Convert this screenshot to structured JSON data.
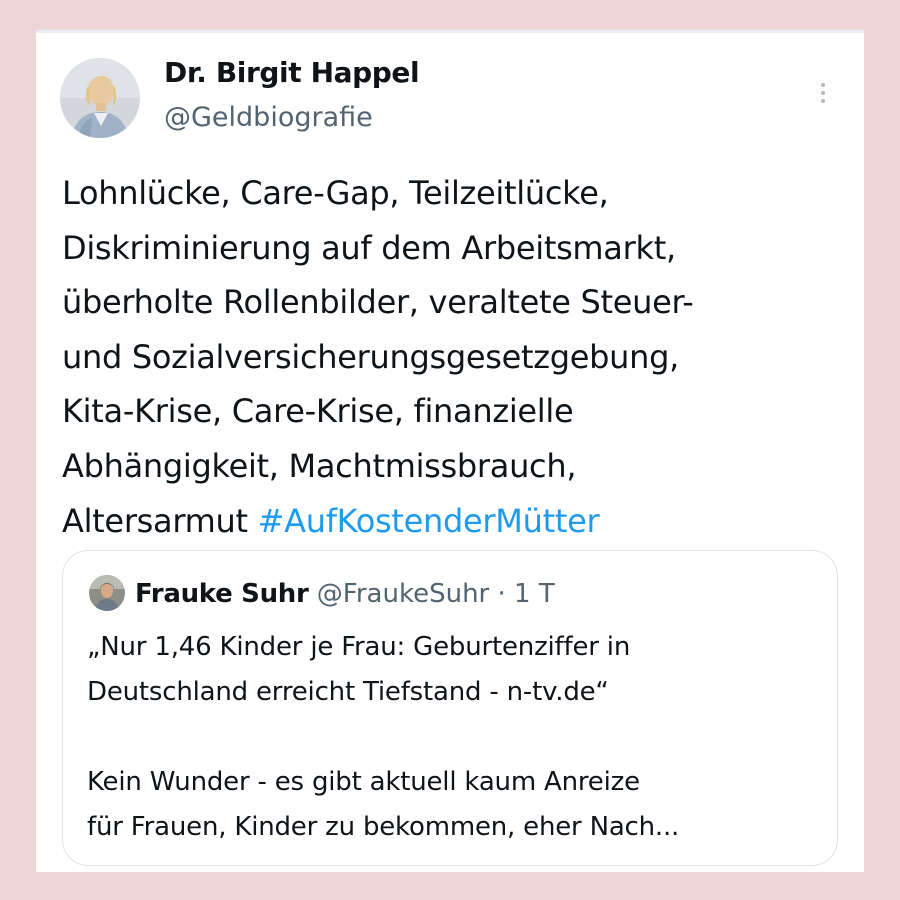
{
  "tweet": {
    "author_name": "Dr. Birgit Happel",
    "author_handle": "@Geldbiografie",
    "text_lines": [
      "Lohnlücke, Care-Gap, Teilzeitlücke,",
      "Diskriminierung auf dem Arbeitsmarkt,",
      "überholte Rollenbilder, veraltete Steuer-",
      "und Sozialversicherungsgesetzgebung,",
      "Kita-Krise, Care-Krise, finanzielle",
      "Abhängigkeit, Machtmissbrauch,",
      "Altersarmut"
    ],
    "hashtag": "#AufKostenderMütter",
    "more_icon": "more-vertical-icon"
  },
  "quote": {
    "author_name": "Frauke Suhr",
    "author_handle": "@FraukeSuhr",
    "separator": "·",
    "time": "1 T",
    "text_lines": [
      "„Nur 1,46 Kinder je Frau: Geburtenziffer in",
      "Deutschland erreicht Tiefstand - n-tv.de“",
      "",
      "Kein Wunder - es gibt aktuell kaum Anreize",
      "für Frauen, Kinder zu bekommen, eher Nach..."
    ]
  },
  "colors": {
    "background": "#eed6d8",
    "card": "#ffffff",
    "text": "#0f1419",
    "secondary": "#536471",
    "link": "#1d9bf0",
    "border": "#dde3e8"
  }
}
